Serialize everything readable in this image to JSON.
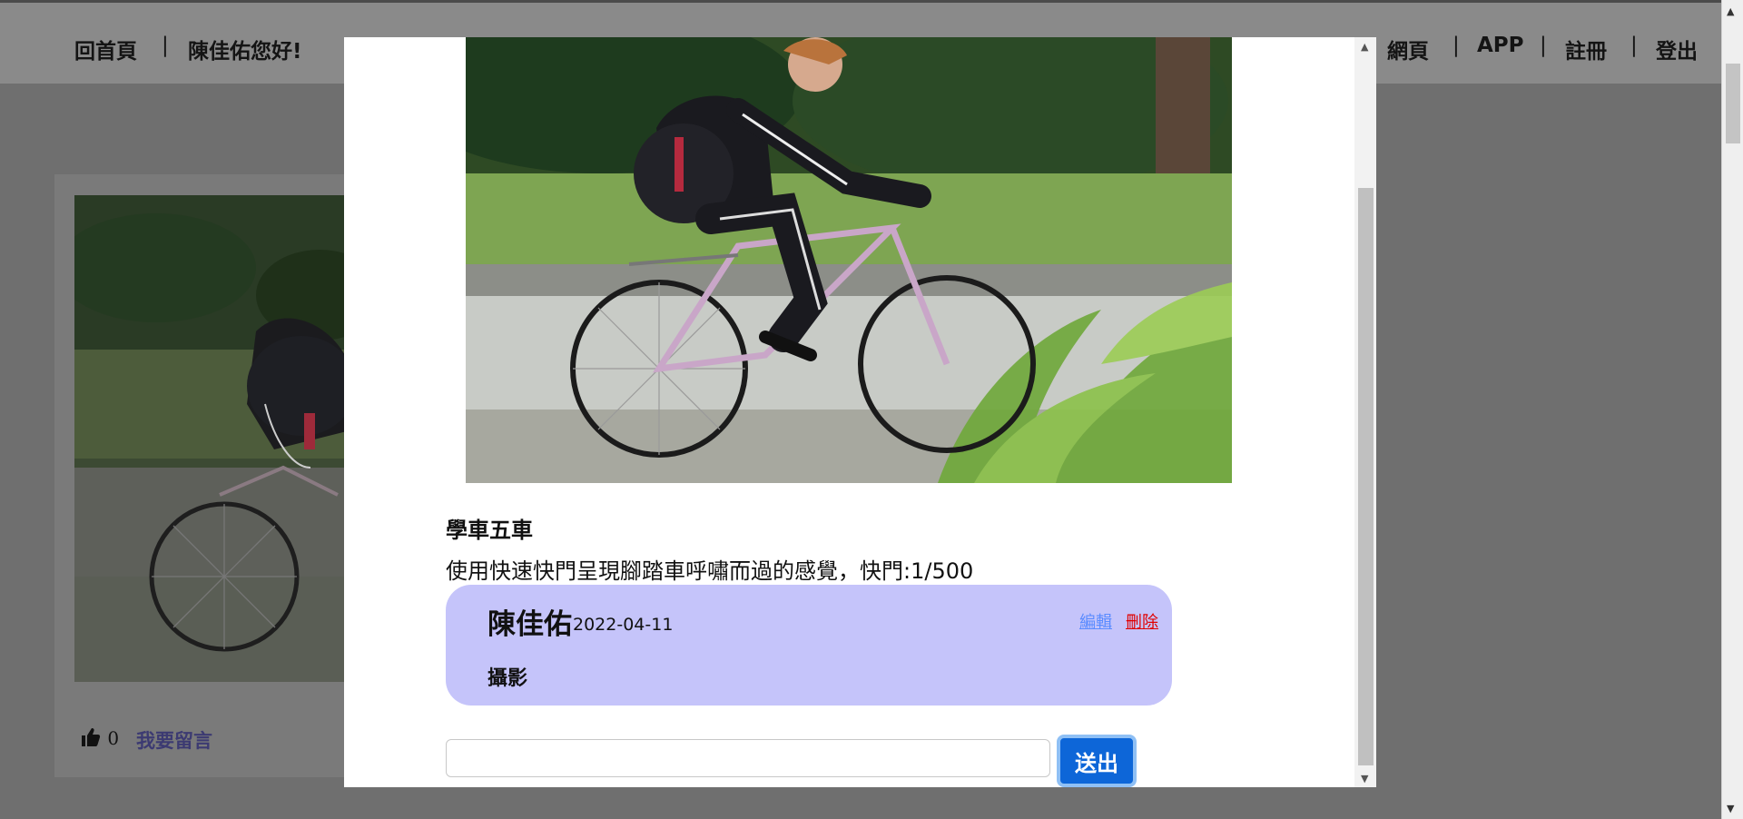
{
  "nav": {
    "home": "回首頁",
    "greeting": "陳佳佑您好!",
    "items": [
      "網頁",
      "APP",
      "註冊",
      "登出"
    ]
  },
  "card": {
    "like_count": "0",
    "comment_link": "我要留言"
  },
  "modal": {
    "post_title": "學車五車",
    "post_description": "使用快速快門呈現腳踏車呼嘯而過的感覺，快門:1/500",
    "comment": {
      "author": "陳佳佑",
      "date": "2022-04-11",
      "edit_label": "編輯",
      "delete_label": "刪除",
      "text": "攝影"
    },
    "input_value": "",
    "send_label": "送出"
  },
  "colors": {
    "comment_bg": "#c5c4fa",
    "send_button": "#0d66d8",
    "edit_link": "#5b8cff",
    "delete_link": "#e00000"
  }
}
